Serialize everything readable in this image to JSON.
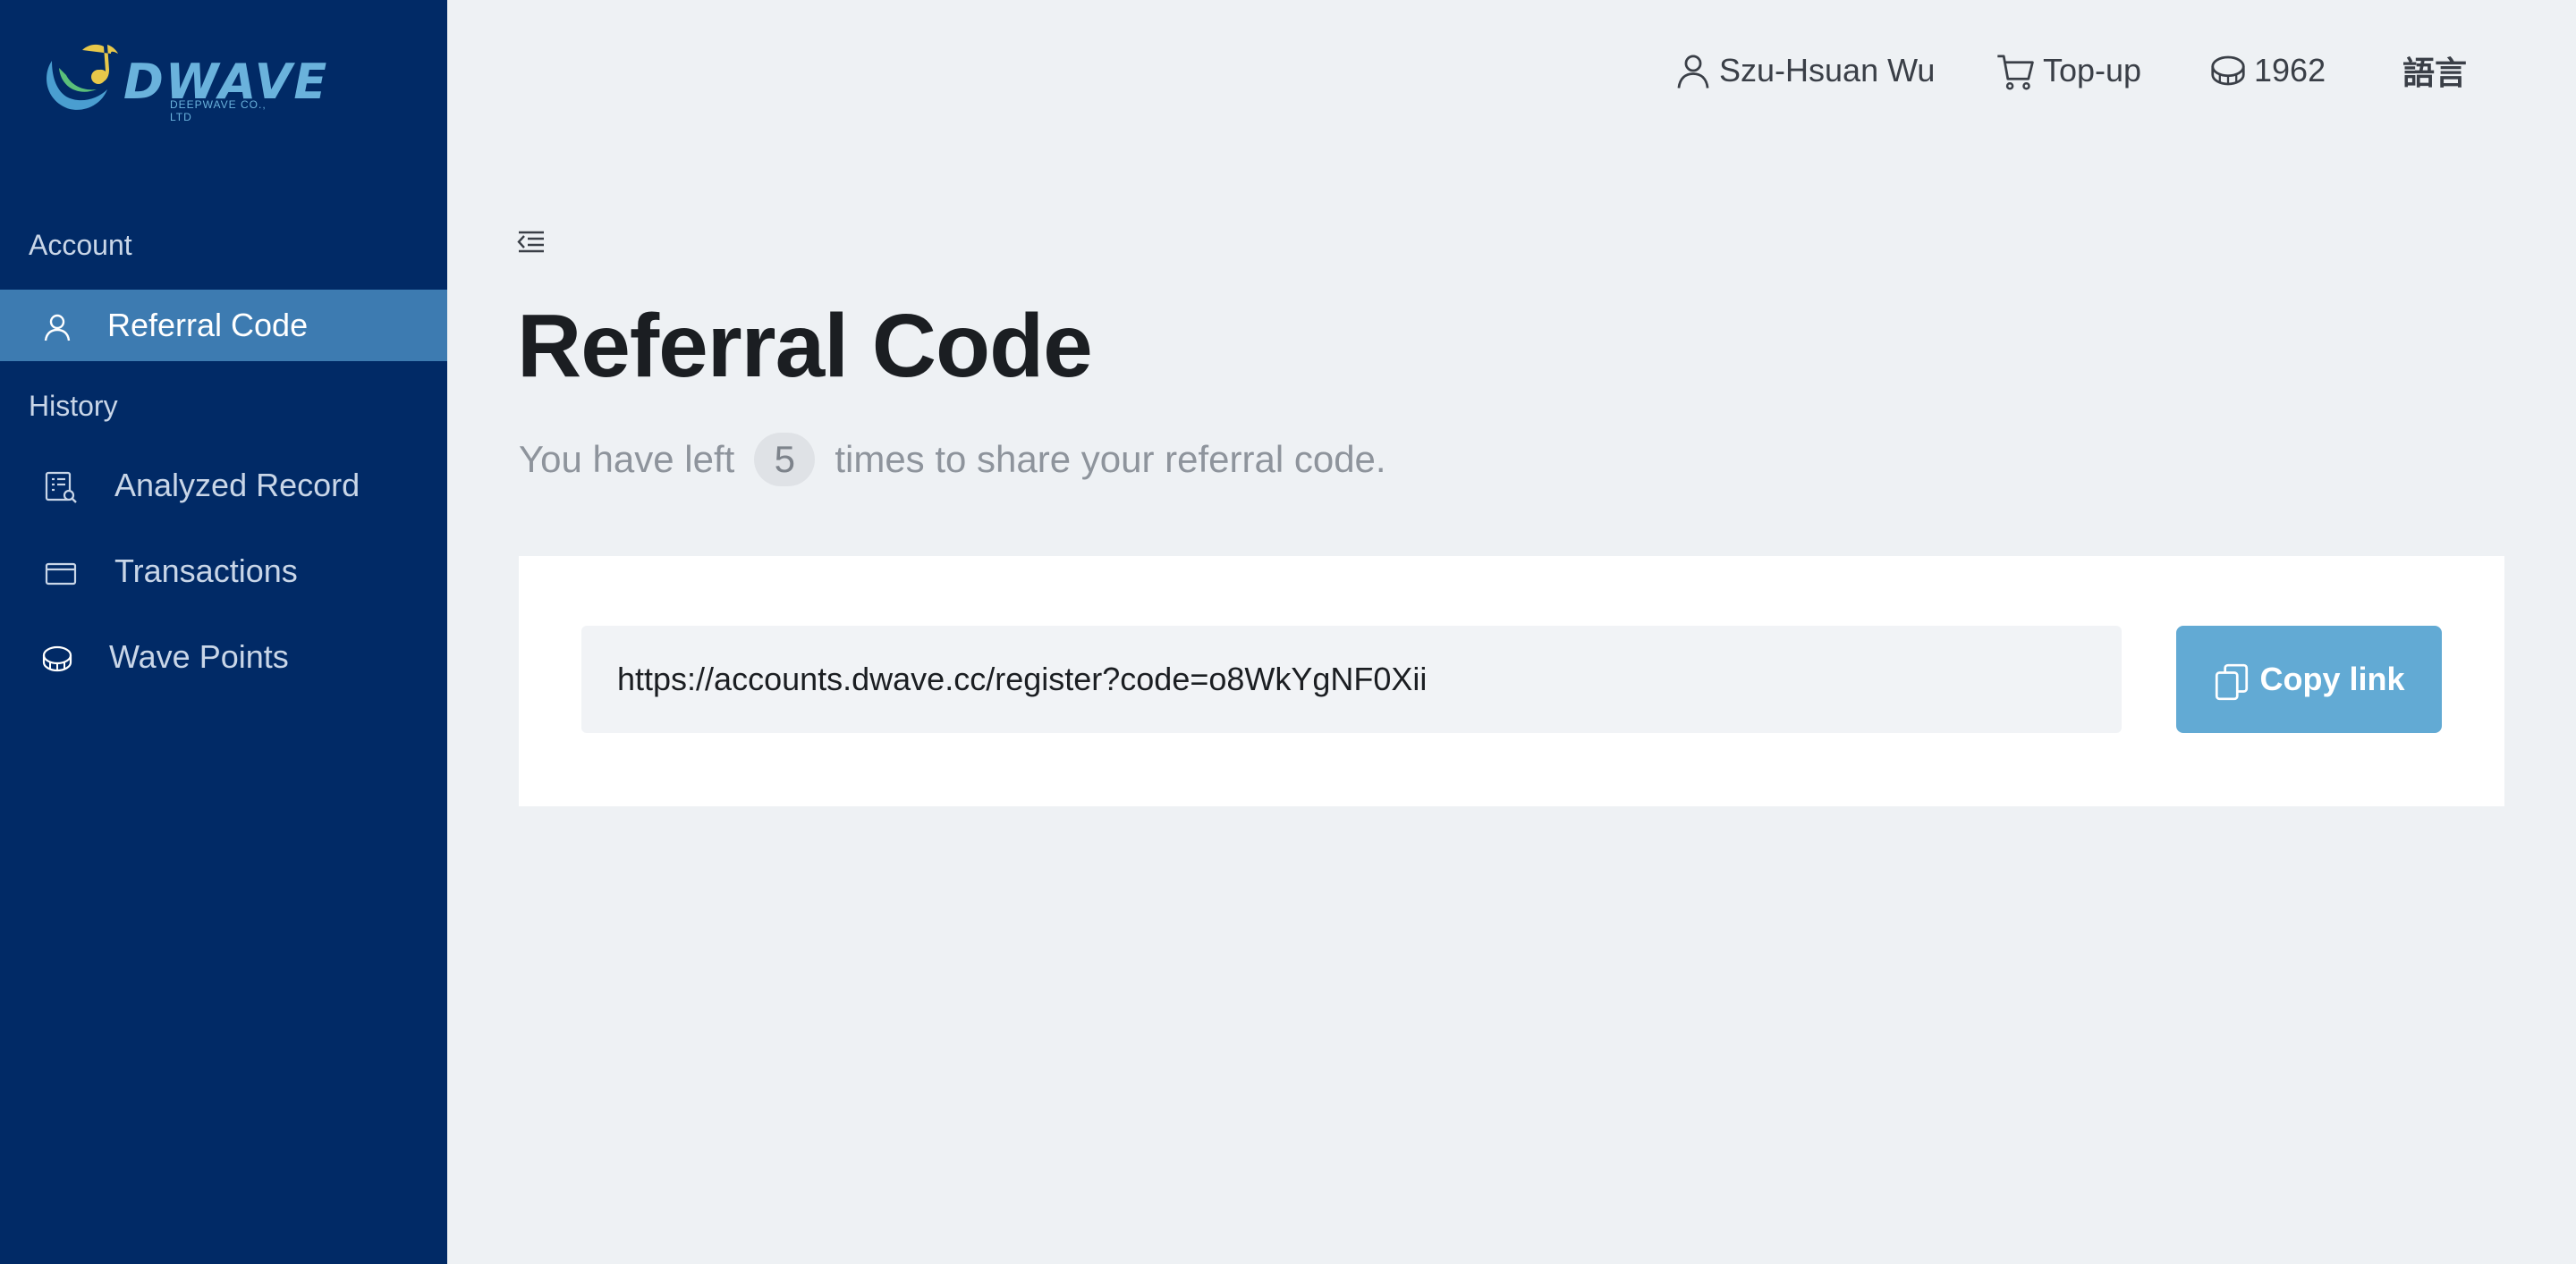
{
  "brand": {
    "wordmark": "DWAVE",
    "company": "DEEPWAVE CO., LTD"
  },
  "colors": {
    "sidebar_bg": "#012a66",
    "sidebar_active": "#3d7bb1",
    "page_bg": "#eef1f4",
    "accent": "#62aad4"
  },
  "sidebar": {
    "sections": [
      {
        "label": "Account",
        "items": [
          {
            "label": "Referral Code",
            "icon": "user-icon",
            "active": true
          }
        ]
      },
      {
        "label": "History",
        "items": [
          {
            "label": "Analyzed Record",
            "icon": "report-search-icon"
          },
          {
            "label": "Transactions",
            "icon": "credit-card-icon"
          },
          {
            "label": "Wave Points",
            "icon": "coin-stack-icon"
          }
        ]
      }
    ]
  },
  "topbar": {
    "user": {
      "name": "Szu-Hsuan Wu",
      "icon": "user-icon"
    },
    "topup": {
      "label": "Top-up",
      "icon": "cart-icon"
    },
    "points": {
      "value": "1962",
      "icon": "coin-icon"
    },
    "language": {
      "label": "語言"
    }
  },
  "main": {
    "collapse_icon": "menu-fold-icon",
    "title": "Referral Code",
    "subtitle": {
      "before": "You have left",
      "count": "5",
      "after": "times to share your referral code."
    },
    "link": {
      "value": "https://accounts.dwave.cc/register?code=o8WkYgNF0Xii"
    },
    "copy_button": {
      "label": "Copy link",
      "icon": "copy-icon"
    }
  }
}
